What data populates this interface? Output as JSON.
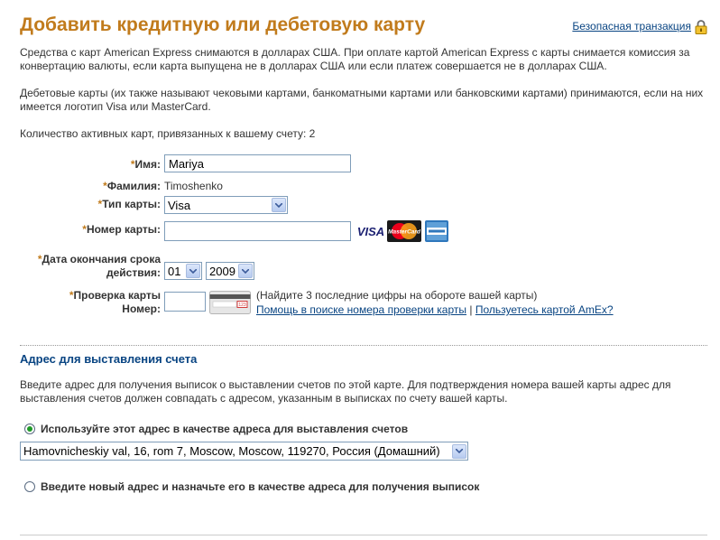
{
  "header": {
    "title": "Добавить кредитную или дебетовую карту",
    "secure_link": "Безопасная транзакция"
  },
  "intro": {
    "amex_note": "Средства с карт American Express снимаются в долларах США. При оплате картой American Express с карты снимается комиссия за конвертацию валюты, если карта выпущена не в долларах США или если платеж совершается не в долларах США.",
    "debit_note": "Дебетовые карты (их также называют чековыми картами, банкоматными картами или банковскими картами) принимаются, если на них имеется логотип Visa или MasterCard.",
    "active_cards": "Количество активных карт, привязанных к вашему счету: 2"
  },
  "form": {
    "required_mark": "*",
    "first_name_label": "Имя:",
    "first_name_value": "Mariya",
    "last_name_label": "Фамилия:",
    "last_name_value": "Timoshenko",
    "card_type_label": "Тип карты:",
    "card_type_value": "Visa",
    "card_number_label": "Номер карты:",
    "card_number_value": "",
    "card_logos": [
      "VISA",
      "MasterCard",
      "American Express"
    ],
    "expiry_label_line1": "Дата окончания срока",
    "expiry_label_line2": "действия:",
    "expiry_month": "01",
    "expiry_year": "2009",
    "cvv_label_line1": "Проверка карты",
    "cvv_label_line2": "Номер:",
    "cvv_value": "",
    "cvv_hint": "(Найдите 3 последние цифры на обороте вашей карты)",
    "cvv_help_link": "Помощь в поиске номера проверки карты",
    "separator": "|",
    "amex_link": "Пользуетесь картой AmEx?",
    "cvv_card_digits": "123"
  },
  "billing": {
    "section_title": "Адрес для выставления счета",
    "description": "Введите адрес для получения выписок о выставлении счетов по этой карте. Для подтверждения номера вашей карты адрес для выставления счетов должен совпадать с адресом, указанным в выписках по счету вашей карты.",
    "use_existing_label": "Используйте этот адрес в качестве адреса для выставления счетов",
    "use_existing_selected": true,
    "address_value": "Hamovnicheskiy val, 16, rom 7, Moscow, Moscow, 119270, Россия (Домашний)",
    "new_address_label": "Введите новый адрес и назначьте его в качестве адреса для получения выписок",
    "new_address_selected": false
  },
  "colors": {
    "title": "#c17b1c",
    "link": "#084482",
    "radio_on": "#1f9a27"
  }
}
